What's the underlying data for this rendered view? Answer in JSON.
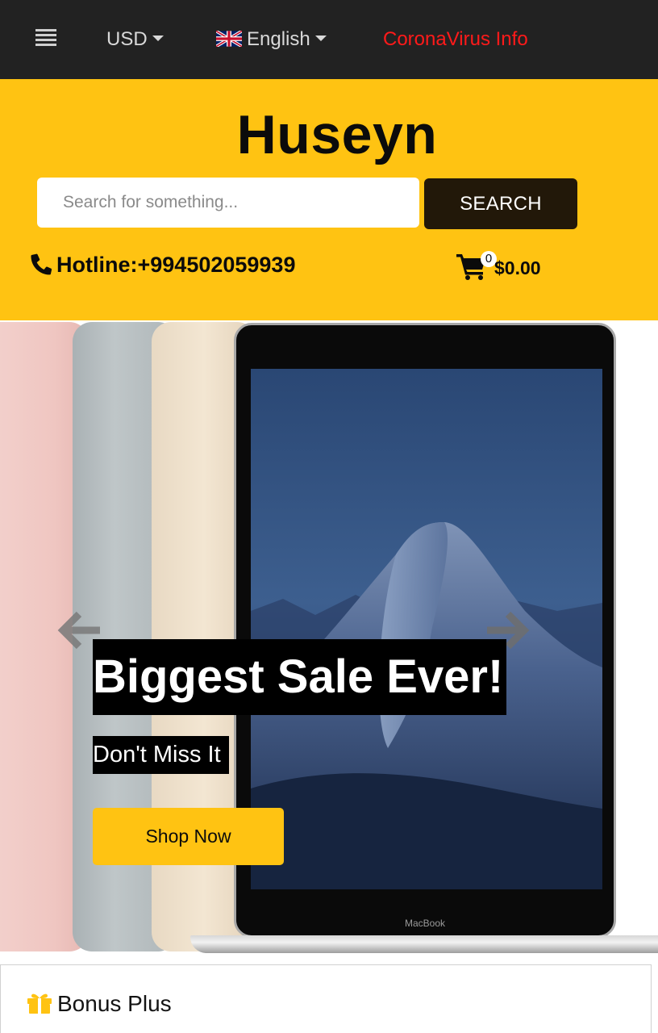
{
  "topbar": {
    "menu_icon": "hamburger-menu-icon",
    "currency": "USD",
    "language": "English",
    "language_flag": "uk-flag-icon",
    "corona_link": "CoronaVirus Info",
    "corona_color": "#ff1a1a"
  },
  "header": {
    "brand": "Huseyn",
    "background_color": "#ffc312",
    "search": {
      "placeholder": "Search for something...",
      "value": "",
      "button_label": "SEARCH"
    },
    "hotline": {
      "icon": "phone-icon",
      "label": "Hotline:",
      "number": "+994502059939"
    },
    "cart": {
      "icon": "shopping-cart-icon",
      "count": "0",
      "total": "$0.00"
    }
  },
  "hero": {
    "title": "Biggest Sale Ever!",
    "subtitle": "Don't Miss It",
    "cta_label": "Shop Now",
    "prev_icon": "arrow-left-icon",
    "next_icon": "arrow-right-icon",
    "device_label": "MacBook"
  },
  "bonus": {
    "icon": "gift-icon",
    "title": "Bonus Plus"
  }
}
